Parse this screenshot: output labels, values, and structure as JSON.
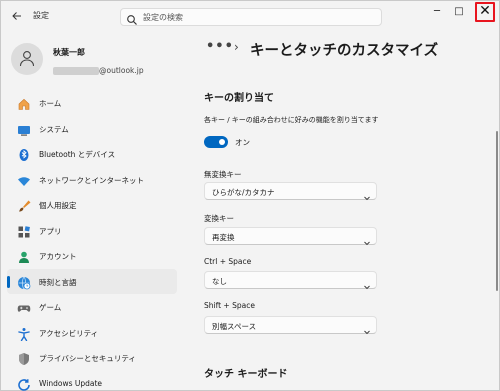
{
  "window": {
    "back_icon": "back-arrow-icon",
    "title": "設定",
    "controls": {
      "minimize": "─",
      "maximize": "□",
      "close": "✕"
    }
  },
  "search": {
    "placeholder": "設定の検索"
  },
  "account": {
    "name": "秋葉一郎",
    "email_suffix": "@outlook.jp"
  },
  "sidebar": {
    "items": [
      {
        "label": "ホーム",
        "icon": "home-icon"
      },
      {
        "label": "システム",
        "icon": "system-icon"
      },
      {
        "label": "Bluetooth とデバイス",
        "icon": "bluetooth-icon"
      },
      {
        "label": "ネットワークとインターネット",
        "icon": "wifi-icon"
      },
      {
        "label": "個人用設定",
        "icon": "brush-icon"
      },
      {
        "label": "アプリ",
        "icon": "apps-icon"
      },
      {
        "label": "アカウント",
        "icon": "account-icon"
      },
      {
        "label": "時刻と言語",
        "icon": "time-language-icon",
        "selected": true
      },
      {
        "label": "ゲーム",
        "icon": "gamepad-icon"
      },
      {
        "label": "アクセシビリティ",
        "icon": "accessibility-icon"
      },
      {
        "label": "プライバシーとセキュリティ",
        "icon": "shield-icon"
      },
      {
        "label": "Windows Update",
        "icon": "update-icon"
      }
    ]
  },
  "main": {
    "breadcrumb_more": "•••",
    "breadcrumb_sep": "›",
    "title": "キーとタッチのカスタマイズ",
    "section_keys": "キーの割り当て",
    "description": "各キー / キーの組み合わせに好みの機能を割り当てます",
    "toggle": {
      "label": "オン",
      "on": true
    },
    "fields": [
      {
        "label": "無変換キー",
        "value": "ひらがな/カタカナ"
      },
      {
        "label": "変換キー",
        "value": "再変換"
      },
      {
        "label": "Ctrl + Space",
        "value": "なし"
      },
      {
        "label": "Shift + Space",
        "value": "別幅スペース"
      }
    ],
    "section_touch": "タッチ キーボード"
  },
  "colors": {
    "accent": "#0067c0",
    "close_highlight": "#e8141e",
    "background": "#f3f3f3"
  }
}
